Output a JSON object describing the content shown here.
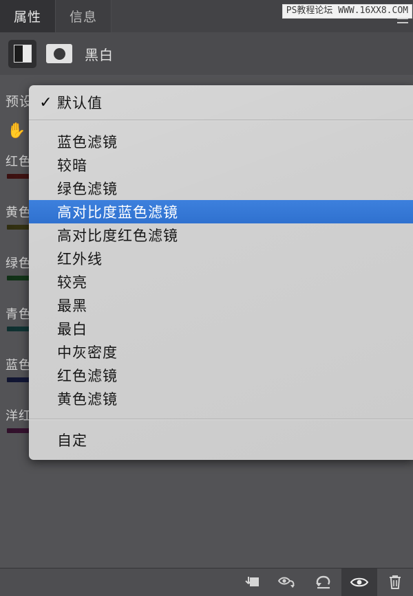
{
  "panel": {
    "tabs": [
      {
        "label": "属性",
        "active": true
      },
      {
        "label": "信息",
        "active": false
      }
    ],
    "menu_button": "panel-menu-icon"
  },
  "watermark": {
    "text": "PS教程论坛 WWW.16XX8.COM"
  },
  "adjustment": {
    "icon": "black-and-white-icon",
    "mask_icon": "layer-mask-icon",
    "title": "黑白"
  },
  "properties": {
    "preset_label": "预设",
    "hand_tool": "on-image-adjust-hand-icon",
    "sliders": [
      {
        "label": "红色",
        "track_from": "#3a1010",
        "track_to": "#8d3a32"
      },
      {
        "label": "黄色",
        "track_from": "#2f2d10",
        "track_to": "#7d7636"
      },
      {
        "label": "绿色",
        "track_from": "#102f16",
        "track_to": "#2f7a3b"
      },
      {
        "label": "青色",
        "track_from": "#0e2e2e",
        "track_to": "#2f7d7d"
      },
      {
        "label": "蓝色",
        "track_from": "#10142f",
        "track_to": "#2f3a8d"
      },
      {
        "label": "洋红",
        "track_from": "#2f1029",
        "track_to": "#8d2f7d"
      }
    ]
  },
  "dropdown": {
    "selected_label": "高对比度蓝色滤镜",
    "check_glyph": "✓",
    "default_item": {
      "label": "默认值",
      "checked": true
    },
    "items": [
      {
        "label": "蓝色滤镜",
        "selected": false
      },
      {
        "label": "较暗",
        "selected": false
      },
      {
        "label": "绿色滤镜",
        "selected": false
      },
      {
        "label": "高对比度蓝色滤镜",
        "selected": true
      },
      {
        "label": "高对比度红色滤镜",
        "selected": false
      },
      {
        "label": "红外线",
        "selected": false
      },
      {
        "label": "较亮",
        "selected": false
      },
      {
        "label": "最黑",
        "selected": false
      },
      {
        "label": "最白",
        "selected": false
      },
      {
        "label": "中灰密度",
        "selected": false
      },
      {
        "label": "红色滤镜",
        "selected": false
      },
      {
        "label": "黄色滤镜",
        "selected": false
      }
    ],
    "custom_item": {
      "label": "自定"
    },
    "highlight_color": "#3579d8",
    "background_color": "#cfcfcf"
  },
  "toolbar": {
    "buttons": [
      {
        "icon": "clip-to-layer-icon",
        "active": false
      },
      {
        "icon": "view-previous-state-icon",
        "active": false
      },
      {
        "icon": "reset-icon",
        "active": false
      },
      {
        "icon": "toggle-visibility-eye-icon",
        "active": true
      },
      {
        "icon": "delete-trash-icon",
        "active": false
      }
    ]
  }
}
